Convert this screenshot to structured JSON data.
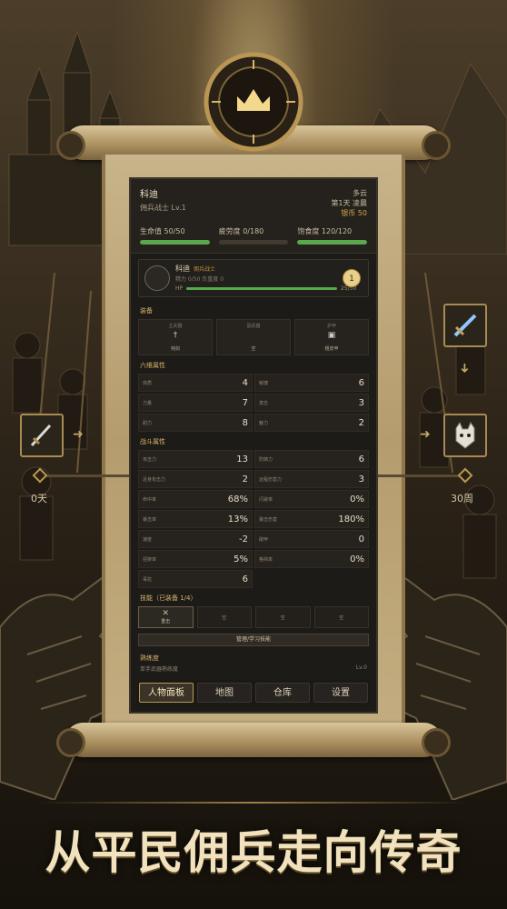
{
  "header": {
    "name": "科迪",
    "class_level": "佣兵战士 Lv.1",
    "weather": "多云",
    "day_time": "第1天 凌晨",
    "coins": "银币 50",
    "hp": "生命值 50/50",
    "fatigue": "疲劳度 0/180",
    "satiety": "饱食度 120/120",
    "hp_pct": 100,
    "fatigue_pct": 0,
    "satiety_pct": 100
  },
  "character": {
    "name": "科迪",
    "title": "佣兵战士",
    "sub": "精力 0/50  负重度 0",
    "hp_label": "HP",
    "hp_value": "25/50",
    "hp_pct": 100,
    "lv_label": "Lv",
    "lv": "1"
  },
  "equipment": {
    "title": "装备",
    "slots": [
      {
        "slot": "主武器",
        "value": "钝剑",
        "icon": "sword-icon"
      },
      {
        "slot": "副武器",
        "value": "空",
        "icon": ""
      },
      {
        "slot": "护甲",
        "value": "粗皮甲",
        "icon": "armor-icon"
      }
    ]
  },
  "attributes": {
    "title": "六维属性",
    "items": [
      {
        "k": "体质",
        "v": "4"
      },
      {
        "k": "敏捷",
        "v": "6"
      },
      {
        "k": "力量",
        "v": "7"
      },
      {
        "k": "意志",
        "v": "3"
      },
      {
        "k": "耐力",
        "v": "8"
      },
      {
        "k": "魅力",
        "v": "2"
      }
    ]
  },
  "combat": {
    "title": "战斗属性",
    "items": [
      {
        "k": "攻击力",
        "v": "13"
      },
      {
        "k": "防御力",
        "v": "6"
      },
      {
        "k": "近身攻击力",
        "v": "2"
      },
      {
        "k": "远程伤害力",
        "v": "3"
      },
      {
        "k": "命中率",
        "v": "68%"
      },
      {
        "k": "闪避率",
        "v": "0%"
      },
      {
        "k": "暴击率",
        "v": "13%"
      },
      {
        "k": "暴击伤害",
        "v": "180%"
      },
      {
        "k": "速度",
        "v": "-2"
      },
      {
        "k": "破甲",
        "v": "0"
      },
      {
        "k": "招架率",
        "v": "5%"
      },
      {
        "k": "格挡率",
        "v": "0%"
      },
      {
        "k": "毒抗",
        "v": "6"
      }
    ]
  },
  "skills": {
    "title": "技能（已装备 1/4）",
    "slots": [
      "重击",
      "空",
      "空",
      "空"
    ],
    "manage": "管理/学习技能"
  },
  "proficiency": {
    "title": "熟练度",
    "row_label": "单手武器熟练度",
    "row_value": "Lv.0"
  },
  "tabs": [
    "人物面板",
    "地图",
    "仓库",
    "设置"
  ],
  "timeline": {
    "start": "0天",
    "end": "30周"
  },
  "slogan": "从平民佣兵走向传奇",
  "colors": {
    "accent": "#d6b36a",
    "hp_green": "#5aa84c",
    "coin": "#d3a44a"
  }
}
